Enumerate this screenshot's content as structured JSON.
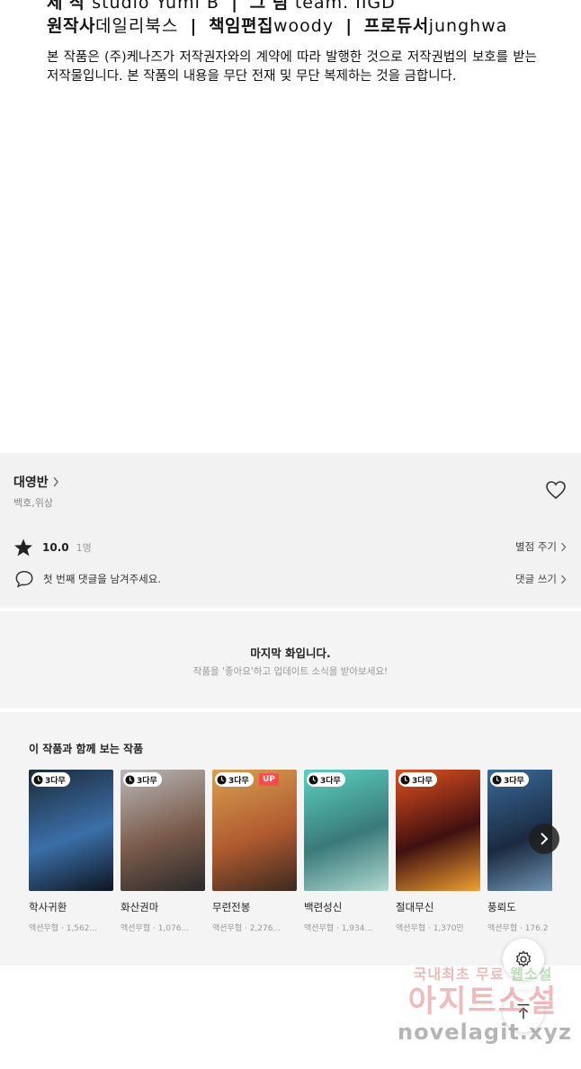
{
  "credits": {
    "line1": {
      "label1": "제 작",
      "value1": "studio Yumi B",
      "label2": "그 림",
      "value2": "team. IIGD"
    },
    "line2": {
      "label1": "원작사",
      "value1": "데일리북스",
      "label2": "책임편집",
      "value2": "woody",
      "label3": "프로듀서",
      "value3": "junghwa"
    },
    "separator": "|",
    "copyright": "본 작품은 (주)케나즈가 저작권자와의 계약에 따라 발행한 것으로 저작권법의 보호를 받는 저작물입니다. 본 작품의 내용을 무단 전재 및 무단 복제하는 것을 금합니다."
  },
  "info": {
    "author": "대영반",
    "genres": "백호,위상",
    "score": "10.0",
    "votes": "1명",
    "rate_label": "별점 주기",
    "comment_prompt": "첫 번째 댓글을 남겨주세요.",
    "comment_label": "댓글 쓰기"
  },
  "last_episode": {
    "title": "마지막 화입니다.",
    "subtitle": "작품을 '좋아요'하고 업데이트 소식을 받아보세요!"
  },
  "recommendations": {
    "title": "이 작품과 함께 보는 작품",
    "items": [
      {
        "title": "학사귀환",
        "meta": "액션무협 · 1,562...",
        "badge": "3다무",
        "up": "",
        "cover_text": "",
        "colors": [
          "#1c2a3a",
          "#3b6fa8",
          "#0e1520"
        ]
      },
      {
        "title": "화산권마",
        "meta": "액션무협 · 1,076...",
        "badge": "3다무",
        "up": "",
        "cover_text": "",
        "colors": [
          "#b8b8b8",
          "#7a5a4a",
          "#2a2a2a"
        ]
      },
      {
        "title": "무련전봉",
        "meta": "액션무협 · 2,276...",
        "badge": "3다무",
        "up": "UP",
        "cover_text": "",
        "colors": [
          "#d9a050",
          "#b05a30",
          "#3a2a20"
        ]
      },
      {
        "title": "백련성신",
        "meta": "액션무협 · 1,934...",
        "badge": "3다무",
        "up": "",
        "cover_text": "",
        "colors": [
          "#5ad0c0",
          "#3a7a7a",
          "#b0d8d0"
        ]
      },
      {
        "title": "절대무신",
        "meta": "액션무협 · 1,370만",
        "badge": "3다무",
        "up": "",
        "cover_text": "",
        "colors": [
          "#e05020",
          "#401010",
          "#f0a030"
        ]
      },
      {
        "title": "풍뢰도",
        "meta": "액션무협 · 176.2",
        "badge": "3다무",
        "up": "",
        "cover_text": "",
        "colors": [
          "#3a6a9a",
          "#1a2a40",
          "#7aa0c0"
        ]
      }
    ]
  },
  "watermark": {
    "line1_a": "국내최초 무료",
    "line1_b": "웹소설",
    "line2": "아지트소설",
    "line3": "novelagit.xyz"
  }
}
